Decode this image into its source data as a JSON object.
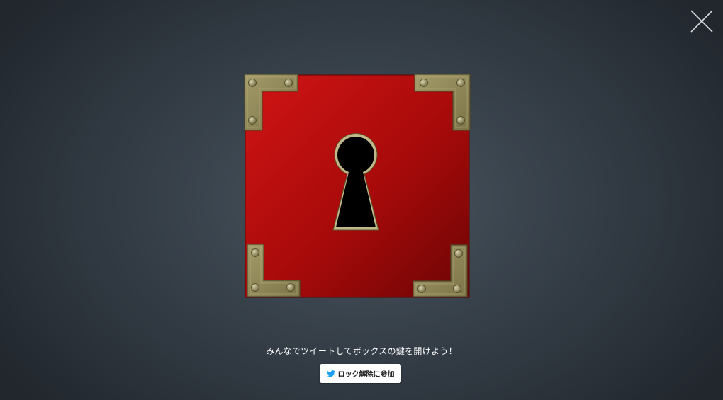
{
  "close_button": {
    "icon": "close-icon"
  },
  "lockbox": {
    "box_color": "#b30a0c",
    "bracket_color": "#8f8656",
    "keyhole_color": "#000000"
  },
  "prompt": {
    "text": "みんなでツイートしてボックスの鍵を開けよう！"
  },
  "join_button": {
    "label": "ロック解除に参加",
    "icon": "twitter-icon",
    "icon_color": "#1da1f2"
  }
}
